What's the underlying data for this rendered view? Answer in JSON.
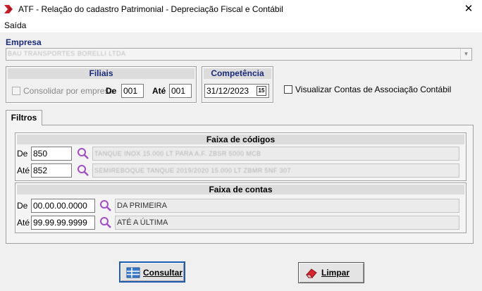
{
  "window": {
    "title": "ATF - Relação do cadastro Patrimonial - Depreciação Fiscal e Contábil",
    "close_glyph": "✕",
    "app_icon": "atf-logo-icon"
  },
  "menu": {
    "items": [
      "Saída"
    ]
  },
  "empresa": {
    "label": "Empresa",
    "value": "BAU TRANSPORTES BORELLI LTDA",
    "dropdown_glyph": "▼"
  },
  "filiais": {
    "header": "Filiais",
    "consolidar_label": "Consolidar por empresa",
    "consolidar_checked": false,
    "de_label": "De",
    "de_value": "001",
    "ate_label": "Até",
    "ate_value": "001"
  },
  "competencia": {
    "header": "Competência",
    "value": "31/12/2023",
    "calendar_glyph": "15"
  },
  "visualizar": {
    "label": "Visualizar Contas de Associação Contábil",
    "checked": false
  },
  "tabs": {
    "filtros": "Filtros"
  },
  "faixa_codigos": {
    "header": "Faixa de códigos",
    "de_label": "De",
    "de_value": "850",
    "de_desc": "TANQUE INOX 15.000 LT PARA A.F. ZBSR 5000 MCB",
    "ate_label": "Até",
    "ate_value": "852",
    "ate_desc": "SEMIREBOQUE TANQUE 2019/2020 15.000 LT ZBMR 5NF 307"
  },
  "faixa_contas": {
    "header": "Faixa de contas",
    "de_label": "De",
    "de_value": "00.00.00.0000",
    "de_desc": "DA PRIMEIRA",
    "ate_label": "Até",
    "ate_value": "99.99.99.9999",
    "ate_desc": "ATÉ A ÚLTIMA"
  },
  "buttons": {
    "consultar": "Consultar",
    "limpar": "Limpar"
  },
  "colors": {
    "accent_blue": "#1a2a7a",
    "search_icon": "#a24fc4",
    "default_button_border": "#1f5bb0",
    "eraser_red": "#d8242c"
  }
}
